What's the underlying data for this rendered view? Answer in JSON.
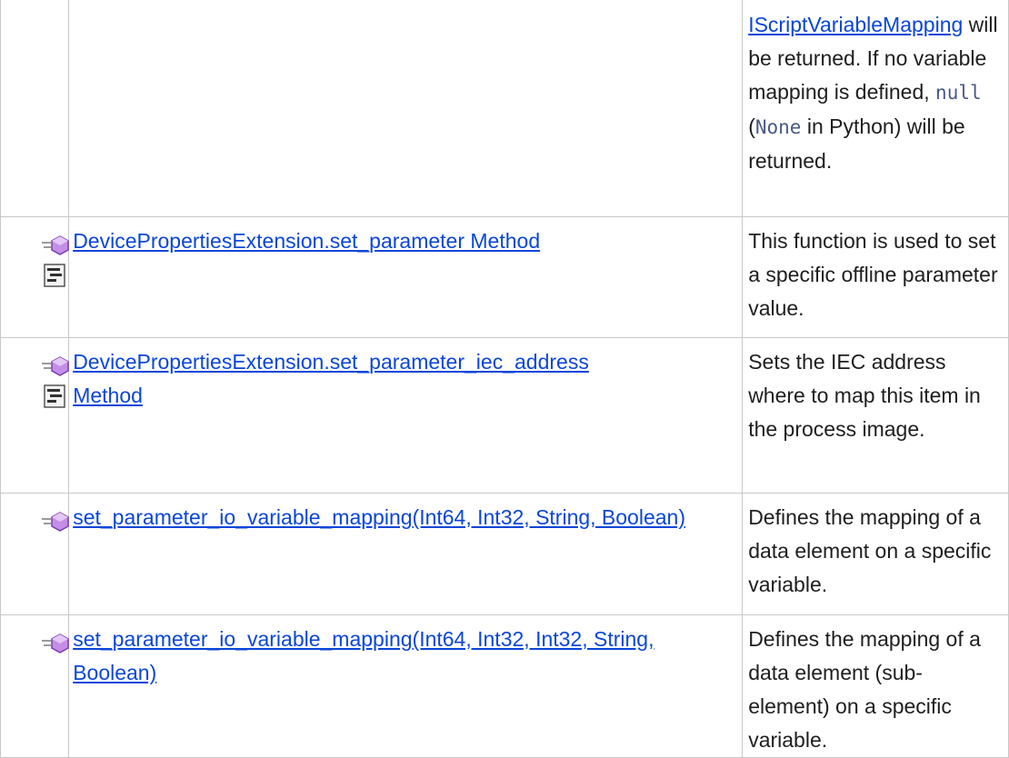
{
  "rows": [
    {
      "name": "",
      "desc_parts": {
        "link": "IScriptVariableMapping",
        "t1": " will be returned. If no variable mapping is defined, ",
        "code1": "null",
        "t2": " (",
        "code2": "None",
        "t3": " in Python) will be returned."
      }
    },
    {
      "name": "DevicePropertiesExtension.set_parameter Method",
      "icons": [
        "method-icon",
        "static-icon"
      ],
      "desc": "This function is used to set a specific offline parameter value."
    },
    {
      "name": "DevicePropertiesExtension.set_parameter_iec_address Method",
      "icons": [
        "method-icon",
        "static-icon"
      ],
      "desc": "Sets the IEC address where to map this item in the process image."
    },
    {
      "name": "set_parameter_io_variable_mapping(Int64, Int32, String, Boolean)",
      "icons": [
        "method-icon"
      ],
      "desc": "Defines the mapping of a data element on a specific variable."
    },
    {
      "name": "set_parameter_io_variable_mapping(Int64, Int32, Int32, String, Boolean)",
      "icons": [
        "method-icon"
      ],
      "desc": "Defines the mapping of a data element (sub-element) on a specific variable."
    }
  ],
  "colors": {
    "link": "#0b46d8",
    "border": "#c8c8c8",
    "code": "#4a5a86",
    "method_icon": "#b07ad8"
  }
}
